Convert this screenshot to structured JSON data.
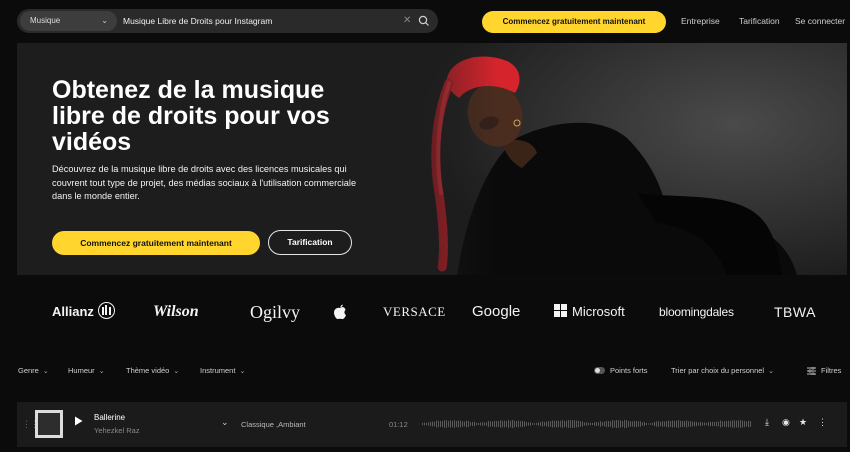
{
  "header": {
    "search": {
      "category": "Musique",
      "value": "Musique Libre de Droits pour Instagram"
    },
    "cta": "Commencez gratuitement maintenant",
    "nav": [
      "Entreprise",
      "Tarification",
      "Se connecter"
    ]
  },
  "hero": {
    "title": "Obtenez de la musique libre de droits pour vos vidéos",
    "description": "Découvrez de la musique libre de droits avec des licences musicales qui couvrent tout type de projet, des médias sociaux à l'utilisation commerciale dans le monde entier.",
    "cta_primary": "Commencez gratuitement maintenant",
    "cta_secondary": "Tarification"
  },
  "logos": [
    "Allianz",
    "Wilson",
    "Ogilvy",
    "",
    "VERSACE",
    "Google",
    "Microsoft",
    "bloomingdales",
    "TBWA"
  ],
  "filters": {
    "genre": "Genre",
    "mood": "Humeur",
    "theme": "Thème vidéo",
    "instrument": "Instrument",
    "highlights": "Points forts",
    "sort": "Trier par choix du personnel",
    "filters": "Filtres"
  },
  "tracks": [
    {
      "title": "Ballerine",
      "artist": "Yehezkel Raz",
      "genres": "Classique ,Ambiant",
      "duration": "01:12"
    }
  ],
  "colors": {
    "accent": "#ffd52e",
    "background": "#0b0b0b",
    "hero_bg": "#1d1d1d",
    "hair_red": "#d5242c"
  }
}
